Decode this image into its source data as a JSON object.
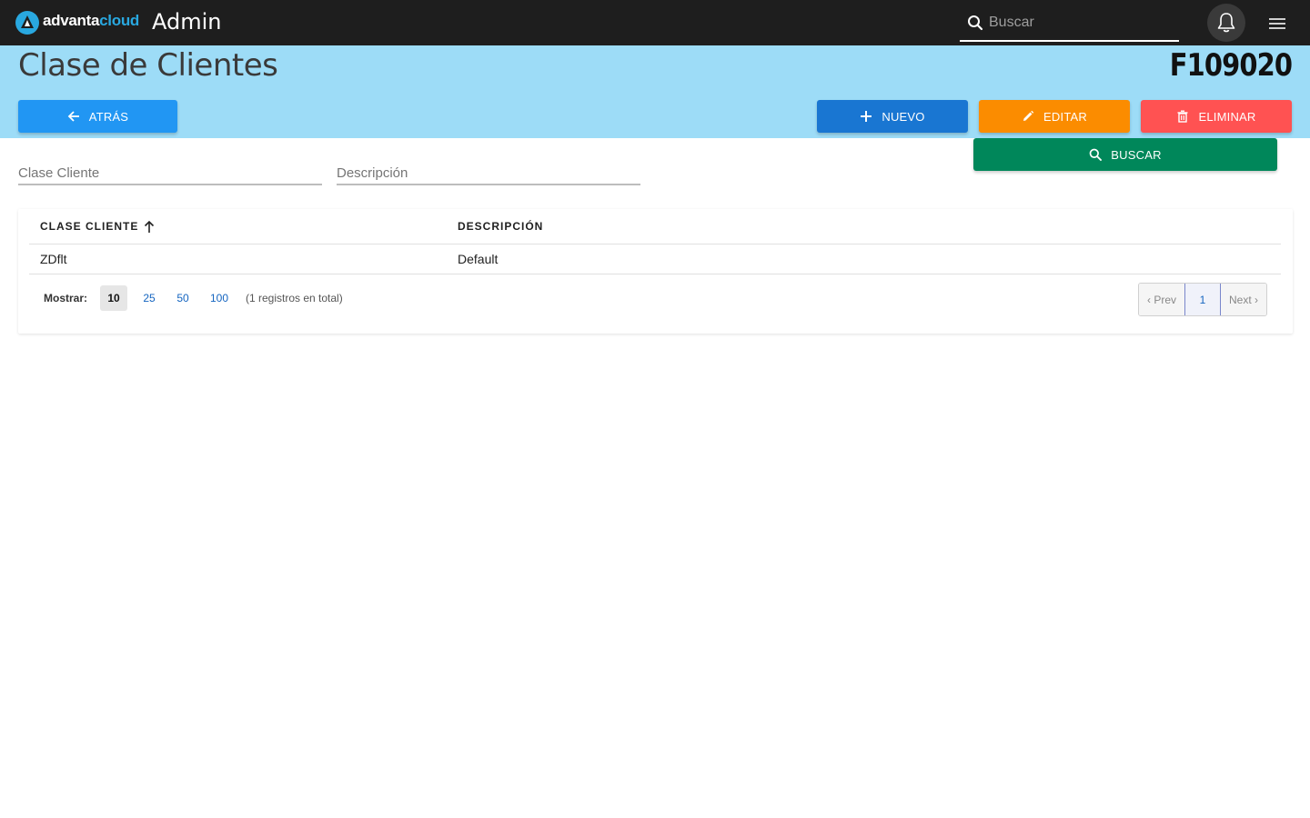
{
  "topbar": {
    "brand_part1": "advanta",
    "brand_part2": "cloud",
    "app_title": "Admin",
    "search_placeholder": "Buscar"
  },
  "header": {
    "title": "Clase de Clientes",
    "code": "F109020"
  },
  "actions": {
    "back_label": "ATRÁS",
    "new_label": "NUEVO",
    "edit_label": "EDITAR",
    "delete_label": "ELIMINAR",
    "search_label": "BUSCAR"
  },
  "filters": {
    "clase_placeholder": "Clase Cliente",
    "desc_placeholder": "Descripción"
  },
  "table": {
    "columns": [
      "CLASE CLIENTE",
      "DESCRIPCIÓN"
    ],
    "sort": "ascending",
    "rows": [
      {
        "clase": "ZDflt",
        "descripcion": "Default"
      }
    ]
  },
  "footer": {
    "show_label": "Mostrar:",
    "page_sizes": [
      "10",
      "25",
      "50",
      "100"
    ],
    "selected_page_size": "10",
    "total_text": "(1 registros en total)",
    "prev_label": "‹ Prev",
    "current_page": "1",
    "next_label": "Next ›"
  },
  "colors": {
    "topbar": "#1e1e1e",
    "header_band": "#9ddcf7",
    "back": "#2196f3",
    "new": "#1976d2",
    "edit": "#fb8c00",
    "delete": "#ff5252",
    "search": "#00875a"
  }
}
